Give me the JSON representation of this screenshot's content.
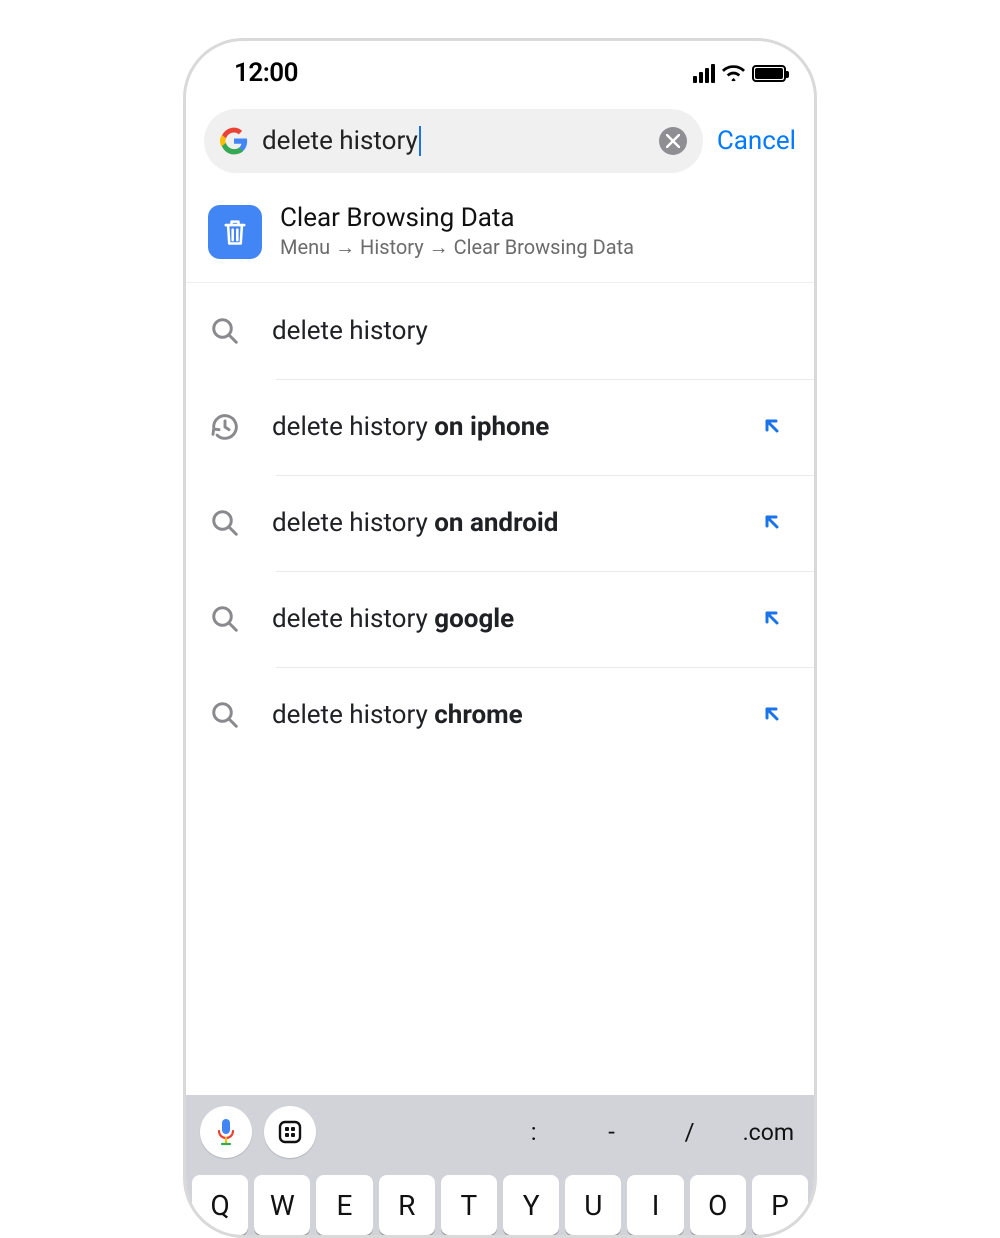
{
  "status": {
    "time": "12:00"
  },
  "search": {
    "query": "delete history",
    "cancel": "Cancel"
  },
  "action": {
    "title": "Clear Browsing Data",
    "subtitle": "Menu → History → Clear Browsing Data"
  },
  "suggestions": [
    {
      "icon": "search",
      "prefix": "delete history",
      "bold": "",
      "arrow": false
    },
    {
      "icon": "history",
      "prefix": "delete history ",
      "bold": "on iphone",
      "arrow": true
    },
    {
      "icon": "search",
      "prefix": "delete history ",
      "bold": "on android",
      "arrow": true
    },
    {
      "icon": "search",
      "prefix": "delete history ",
      "bold": "google",
      "arrow": true
    },
    {
      "icon": "search",
      "prefix": "delete history ",
      "bold": "chrome",
      "arrow": true
    }
  ],
  "keyboard": {
    "symbols": {
      "colon": ":",
      "dash": "-",
      "slash": "/",
      "com": ".com"
    },
    "row1": [
      "Q",
      "W",
      "E",
      "R",
      "T",
      "Y",
      "U",
      "I",
      "O",
      "P"
    ]
  }
}
